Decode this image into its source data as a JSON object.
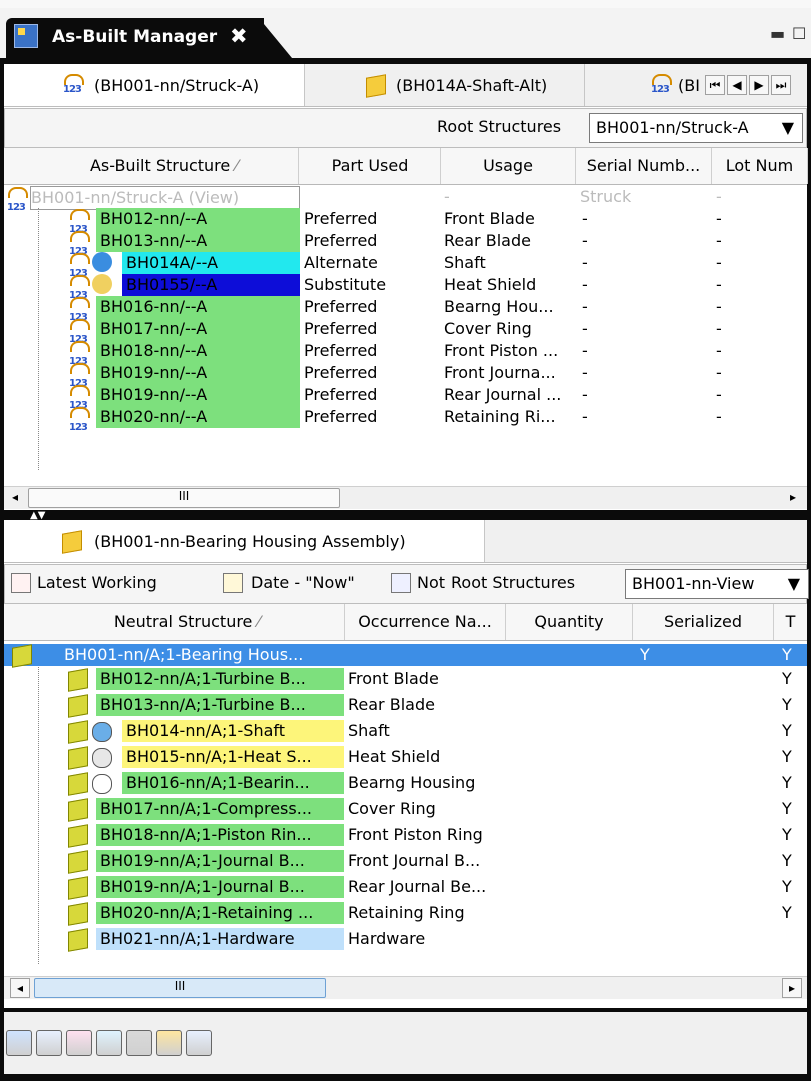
{
  "window": {
    "title": "As-Built Manager",
    "close_glyph": "✖"
  },
  "top_pane": {
    "tabs": [
      {
        "label": "(BH001-nn/Struck-A)",
        "icon": "asbuilt-123-icon"
      },
      {
        "label": "(BH014A-Shaft-Alt)",
        "icon": "cube-icon"
      },
      {
        "label": "(BI",
        "icon": "asbuilt-123-icon"
      }
    ],
    "root_structures_label": "Root Structures",
    "root_structures_value": "BH001-nn/Struck-A",
    "columns": [
      "As-Built Structure",
      "Part Used",
      "Usage",
      "Serial Numb...",
      "Lot Num"
    ],
    "root_row": {
      "name": "BH001-nn/Struck-A (View)",
      "part": "",
      "usage": "-",
      "serial": "Struck",
      "lot": "-"
    },
    "rows": [
      {
        "name": "BH012-nn/--A",
        "part": "Preferred",
        "usage": "Front Blade",
        "serial": "-",
        "lot": "-",
        "bg": "#7de07d",
        "fg": "#000000"
      },
      {
        "name": "BH013-nn/--A",
        "part": "Preferred",
        "usage": "Rear Blade",
        "serial": "-",
        "lot": "-",
        "bg": "#7de07d",
        "fg": "#000000"
      },
      {
        "name": "BH014A/--A",
        "part": "Alternate",
        "usage": "Shaft",
        "serial": "-",
        "lot": "-",
        "bg": "#22e8ee",
        "fg": "#000000"
      },
      {
        "name": "BH0155/--A",
        "part": "Substitute",
        "usage": "Heat Shield",
        "serial": "-",
        "lot": "-",
        "bg": "#0d0dd8",
        "fg": "#000000"
      },
      {
        "name": "BH016-nn/--A",
        "part": "Preferred",
        "usage": "Bearng Hou...",
        "serial": "-",
        "lot": "-",
        "bg": "#7de07d",
        "fg": "#000000"
      },
      {
        "name": "BH017-nn/--A",
        "part": "Preferred",
        "usage": "Cover Ring",
        "serial": "-",
        "lot": "-",
        "bg": "#7de07d",
        "fg": "#000000"
      },
      {
        "name": "BH018-nn/--A",
        "part": "Preferred",
        "usage": "Front Piston ...",
        "serial": "-",
        "lot": "-",
        "bg": "#7de07d",
        "fg": "#000000"
      },
      {
        "name": "BH019-nn/--A",
        "part": "Preferred",
        "usage": "Front Journa...",
        "serial": "-",
        "lot": "-",
        "bg": "#7de07d",
        "fg": "#000000"
      },
      {
        "name": "BH019-nn/--A",
        "part": "Preferred",
        "usage": "Rear Journal ...",
        "serial": "-",
        "lot": "-",
        "bg": "#7de07d",
        "fg": "#000000"
      },
      {
        "name": "BH020-nn/--A",
        "part": "Preferred",
        "usage": "Retaining Ri...",
        "serial": "-",
        "lot": "-",
        "bg": "#7de07d",
        "fg": "#000000"
      }
    ],
    "scroll_thumb": "III"
  },
  "bottom_pane": {
    "tab": "(BH001-nn-Bearing Housing Assembly)",
    "toolbar": {
      "latest_working": "Latest Working",
      "date": "Date - \"Now\"",
      "not": "Not",
      "root_structures_label": "Root Structures",
      "root_structures_value": "BH001-nn-View"
    },
    "columns": [
      "Neutral Structure",
      "Occurrence Na...",
      "Quantity",
      "Serialized",
      "T"
    ],
    "root_row": {
      "name": "BH001-nn/A;1-Bearing Hous...",
      "serialized": "Y",
      "t": "Y"
    },
    "rows": [
      {
        "name": "BH012-nn/A;1-Turbine B...",
        "occ": "Front Blade",
        "t": "Y",
        "bg": "#7de07d"
      },
      {
        "name": "BH013-nn/A;1-Turbine B...",
        "occ": "Rear Blade",
        "t": "Y",
        "bg": "#7de07d"
      },
      {
        "name": "BH014-nn/A;1-Shaft",
        "occ": "Shaft",
        "t": "Y",
        "bg": "#fdf57a"
      },
      {
        "name": "BH015-nn/A;1-Heat S...",
        "occ": "Heat Shield",
        "t": "Y",
        "bg": "#fdf57a"
      },
      {
        "name": "BH016-nn/A;1-Bearin...",
        "occ": "Bearng Housing",
        "t": "Y",
        "bg": "#7de07d"
      },
      {
        "name": "BH017-nn/A;1-Compress...",
        "occ": "Cover Ring",
        "t": "Y",
        "bg": "#7de07d"
      },
      {
        "name": "BH018-nn/A;1-Piston Rin...",
        "occ": "Front Piston Ring",
        "t": "Y",
        "bg": "#7de07d"
      },
      {
        "name": "BH019-nn/A;1-Journal B...",
        "occ": "Front Journal B...",
        "t": "Y",
        "bg": "#7de07d"
      },
      {
        "name": "BH019-nn/A;1-Journal B...",
        "occ": "Rear Journal Be...",
        "t": "Y",
        "bg": "#7de07d"
      },
      {
        "name": "BH020-nn/A;1-Retaining ...",
        "occ": "Retaining Ring",
        "t": "Y",
        "bg": "#7de07d"
      },
      {
        "name": "BH021-nn/A;1-Hardware",
        "occ": "Hardware",
        "t": "",
        "bg": "#bfe0fb"
      }
    ],
    "scroll_thumb": "III",
    "footer_icons": [
      "view-icon",
      "new-icon",
      "compare-icon",
      "refresh-icon",
      "filter-icon",
      "assembly-icon",
      "search-icon"
    ]
  }
}
